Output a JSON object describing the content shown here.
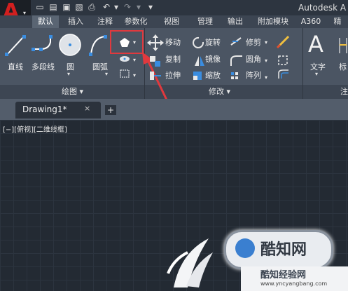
{
  "app": {
    "title": "Autodesk A",
    "logo_letter": "A",
    "logo_color": "#d21f1f"
  },
  "quick_access": [
    "new-icon",
    "open-icon",
    "save-icon",
    "save-as-icon",
    "print-icon",
    "undo-icon",
    "redo-icon",
    "more-icon"
  ],
  "ribbon_tabs": [
    "默认",
    "插入",
    "注释",
    "参数化",
    "视图",
    "管理",
    "输出",
    "附加模块",
    "A360",
    "精"
  ],
  "draw_panel": {
    "tools": {
      "line": "直线",
      "polyline": "多段线",
      "circle": "圆",
      "arc": "圆弧"
    },
    "footer": "绘图"
  },
  "modify_panel": {
    "tools": {
      "move": "移动",
      "rotate": "旋转",
      "trim": "修剪",
      "copy": "复制",
      "mirror": "镜像",
      "fillet": "圆角",
      "stretch": "拉伸",
      "scale": "缩放",
      "array": "阵列"
    },
    "footer": "修改"
  },
  "annotation_panel": {
    "text": "文字",
    "dim_partial": "标",
    "footer_partial": "注"
  },
  "highlight": {
    "target": "polygon-button",
    "color": "#e0393e"
  },
  "document": {
    "tab_label": "Drawing1*",
    "close_symbol": "×",
    "new_tab_symbol": "+"
  },
  "viewport": {
    "label": "[−][俯视][二维线框]"
  },
  "watermark": {
    "text_main": "酷知网",
    "text_sub": "酷知经验网",
    "url": "www.yncyangbang.com"
  }
}
